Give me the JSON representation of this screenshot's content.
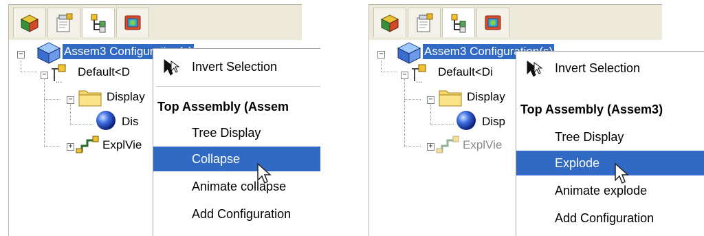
{
  "panels": [
    {
      "tree": {
        "root_label": "Assem3 Configuration(s)",
        "default_label": "Default<D",
        "display_label": "Display",
        "display_child_label": "Dis",
        "explview_label": "ExplVie"
      },
      "menu": {
        "invert_selection": "Invert Selection",
        "section_header": "Top Assembly (Assem",
        "tree_display": "Tree Display",
        "action": "Collapse",
        "animate": "Animate collapse",
        "add_configuration": "Add Configuration"
      }
    },
    {
      "tree": {
        "root_label": "Assem3 Configuration(s)",
        "default_label": "Default<Di",
        "display_label": "Display",
        "display_child_label": "Disp",
        "explview_label": "ExplVie"
      },
      "menu": {
        "invert_selection": "Invert Selection",
        "section_header": "Top Assembly (Assem3)",
        "tree_display": "Tree Display",
        "action": "Explode",
        "animate": "Animate explode",
        "add_configuration": "Add Configuration"
      }
    }
  ],
  "colors": {
    "selection": "#316ac5",
    "panel_bg": "#ece9d8",
    "menu_border": "#a7a7a7"
  },
  "icons": [
    "feature-manager-icon",
    "property-manager-icon",
    "configuration-manager-icon",
    "display-manager-icon",
    "assembly-icon",
    "configuration-icon",
    "folder-icon",
    "sphere-icon",
    "exploded-view-icon",
    "invert-selection-icon",
    "mouse-pointer-icon"
  ]
}
